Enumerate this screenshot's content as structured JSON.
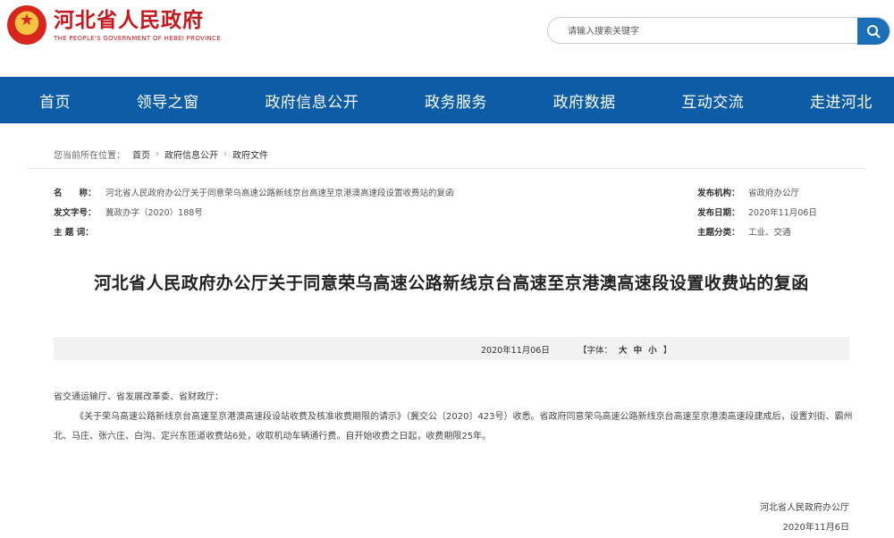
{
  "header": {
    "site_name": "河北省人民政府",
    "site_name_en": "THE PEOPLE'S GOVERNMENT OF HEBEI PROVINCE",
    "search_placeholder": "请输入搜索关键字"
  },
  "nav": {
    "items": [
      "首页",
      "领导之窗",
      "政府信息公开",
      "政务服务",
      "政府数据",
      "互动交流",
      "走进河北"
    ]
  },
  "breadcrumb": {
    "prefix": "您当前所在位置：",
    "items": [
      "首页",
      "政府信息公开",
      "政府文件"
    ]
  },
  "meta": {
    "name_label": "名　　称：",
    "name_value": "河北省人民政府办公厅关于同意荣乌高速公路新线京台高速至京港澳高速段设置收费站的复函",
    "docno_label": "发文字号：",
    "docno_value": "冀政办字（2020）188号",
    "subject_label": "主 题 词：",
    "subject_value": "",
    "org_label": "发布机构：",
    "org_value": "省政府办公厅",
    "date_label": "发布日期：",
    "date_value": "2020年11月06日",
    "category_label": "主题分类：",
    "category_value": "工业、交通"
  },
  "article": {
    "title": "河北省人民政府办公厅关于同意荣乌高速公路新线京台高速至京港澳高速段设置收费站的复函",
    "date": "2020年11月06日",
    "font_label": "【字体：",
    "font_large": "大",
    "font_medium": "中",
    "font_small": "小",
    "font_end": "】",
    "addressee": "省交通运输厅、省发展改革委、省财政厅：",
    "paragraph": "《关于荣乌高速公路新线京台高速至京港澳高速段设站收费及核准收费期限的请示》（冀交公〔2020〕423号）收悉。省政府同意荣乌高速公路新线京台高速至京港澳高速段建成后，设置刘街、霸州北、马庄、张六庄、白沟、定兴东匝道收费站6处，收取机动车辆通行费。自开始收费之日起，收费期限25年。",
    "sign_org": "河北省人民政府办公厅",
    "sign_date": "2020年11月6日"
  },
  "colors": {
    "brand_red": "#c8161d",
    "nav_blue": "#0c5ca8",
    "search_blue": "#1a6fb8"
  }
}
